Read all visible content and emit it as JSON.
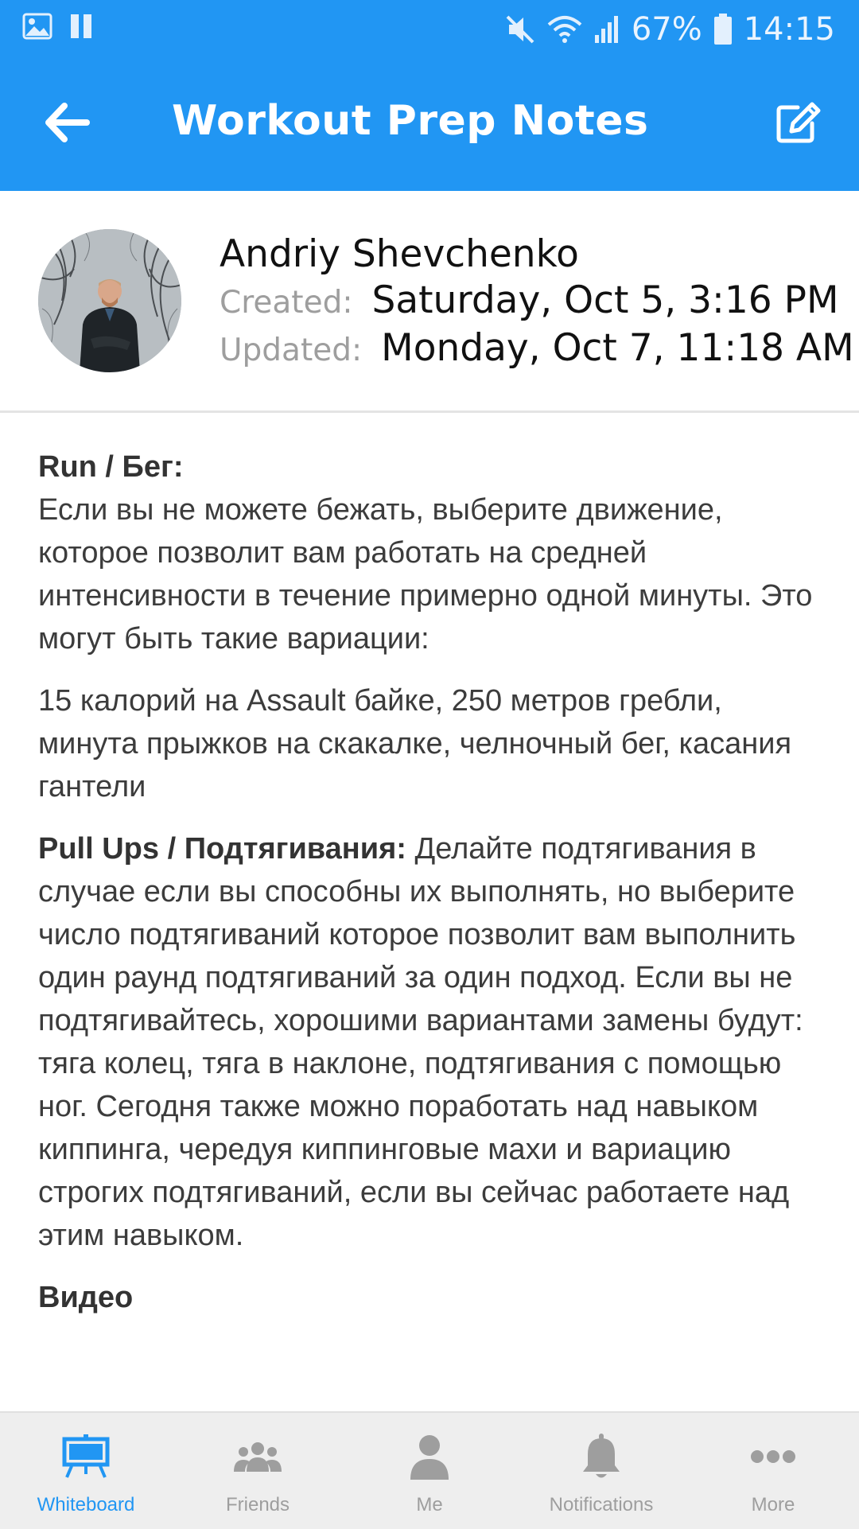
{
  "status_bar": {
    "battery": "67%",
    "time": "14:15",
    "icons": [
      "image-icon",
      "pause-icon",
      "mute-icon",
      "wifi-icon",
      "signal-icon",
      "battery-icon"
    ]
  },
  "app_bar": {
    "title": "Workout Prep Notes",
    "icons": [
      "back-arrow-icon",
      "edit-icon"
    ],
    "color": "#2196f3"
  },
  "note": {
    "author": "Andriy Shevchenko",
    "created_label": "Created:",
    "created_value": "Saturday, Oct 5, 3:16 PM",
    "updated_label": "Updated:",
    "updated_value": "Monday, Oct 7, 11:18 AM"
  },
  "content": {
    "run_heading": "Run / Бег:",
    "run_text": "Если вы не можете бежать, выберите движение, которое позволит вам работать на средней интенсивности в течение примерно одной минуты. Это могут быть такие вариации:",
    "run_variations": "15 калорий на Assault байке, 250 метров гребли, минута прыжков на скакалке, челночный бег, касания гантели",
    "pullups_heading": "Pull Ups / Подтягивания:",
    "pullups_text": "Делайте подтягивания в случае если вы способны их выполнять, но выберите число подтягиваний которое позволит вам выполнить один раунд подтягиваний за один подход. Если вы не подтягивайтесь, хорошими вариантами замены будут: тяга колец, тяга в наклоне, подтягивания с помощью ног. Сегодня также можно поработать над навыком киппинга, чередуя киппинговые махи и вариацию строгих подтягиваний, если вы сейчас работаете над этим навыком.",
    "video_heading": "Видео"
  },
  "bottom_nav": {
    "active_color": "#2196f3",
    "items": [
      {
        "label": "Whiteboard",
        "icon": "whiteboard-icon",
        "active": true
      },
      {
        "label": "Friends",
        "icon": "friends-icon",
        "active": false
      },
      {
        "label": "Me",
        "icon": "person-icon",
        "active": false
      },
      {
        "label": "Notifications",
        "icon": "bell-icon",
        "active": false
      },
      {
        "label": "More",
        "icon": "more-dots-icon",
        "active": false
      }
    ]
  }
}
